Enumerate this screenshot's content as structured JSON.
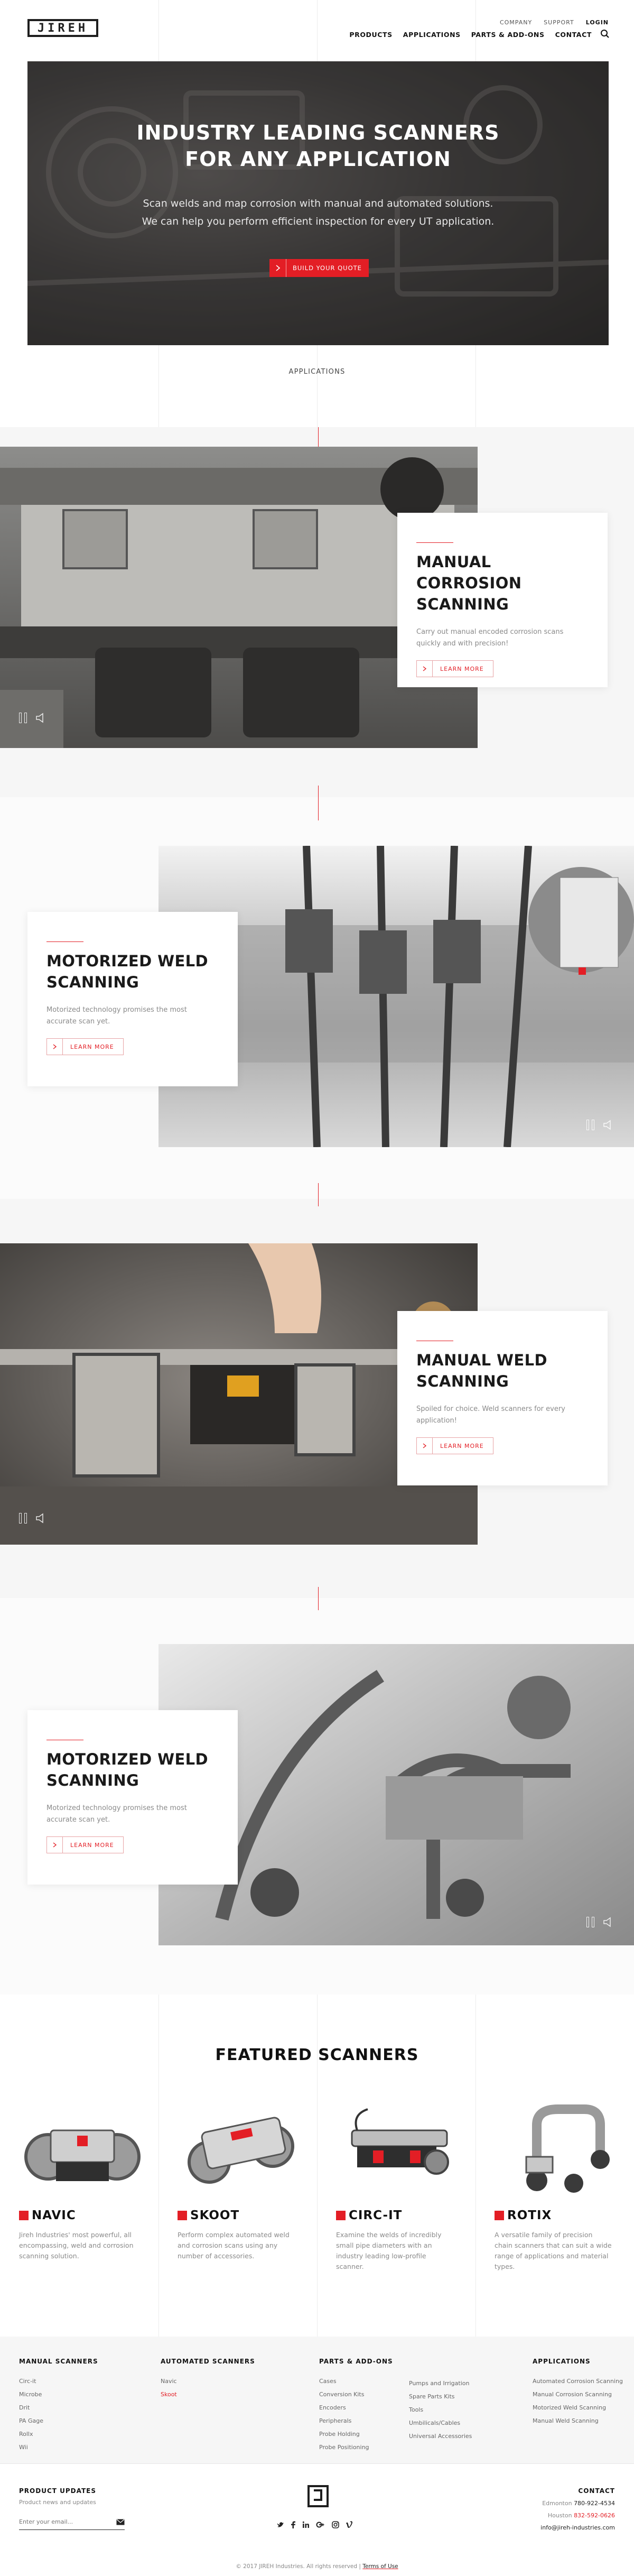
{
  "header": {
    "logo_text": "JIREH",
    "utility_nav": [
      "COMPANY",
      "SUPPORT",
      "LOGIN"
    ],
    "main_nav": [
      "PRODUCTS",
      "APPLICATIONS",
      "PARTS & ADD-ONS",
      "CONTACT"
    ],
    "search_icon": "search-icon"
  },
  "hero": {
    "title_line1": "INDUSTRY LEADING SCANNERS",
    "title_line2": "FOR ANY APPLICATION",
    "subtitle_line1": "Scan welds and map corrosion with manual and automated solutions.",
    "subtitle_line2": "We can help you perform efficient inspection for every UT application.",
    "cta_label": "BUILD YOUR QUOTE"
  },
  "applications": {
    "section_label": "APPLICATIONS",
    "items": [
      {
        "title_line1": "MANUAL CORROSION",
        "title_line2": "SCANNING",
        "description": "Carry out manual encoded corrosion scans quickly and with precision!",
        "button": "LEARN MORE"
      },
      {
        "title_line1": "MOTORIZED WELD",
        "title_line2": "SCANNING",
        "description": "Motorized technology promises the most accurate scan yet.",
        "button": "LEARN MORE"
      },
      {
        "title_line1": "MANUAL WELD",
        "title_line2": "SCANNING",
        "description": "Spoiled for choice. Weld scanners for every application!",
        "button": "LEARN MORE"
      },
      {
        "title_line1": "MOTORIZED WELD",
        "title_line2": "SCANNING",
        "description": "Motorized technology promises the most accurate scan yet.",
        "button": "LEARN MORE"
      }
    ]
  },
  "featured": {
    "title": "FEATURED SCANNERS",
    "products": [
      {
        "name": "NAVIC",
        "description": "Jireh Industries' most powerful, all encompassing, weld and corrosion scanning solution."
      },
      {
        "name": "SKOOT",
        "description": "Perform complex automated weld and corrosion scans using any number of accessories."
      },
      {
        "name": "CIRC-IT",
        "description": "Examine the welds of incredibly small pipe diameters with an industry leading low-profile scanner."
      },
      {
        "name": "ROTIX",
        "description": "A versatile family of precision chain scanners that can suit a wide range of applications and material types."
      }
    ]
  },
  "footer": {
    "columns": [
      {
        "heading": "MANUAL SCANNERS",
        "links": [
          "Circ-it",
          "Microbe",
          "Drit",
          "PA Gage",
          "Rollx",
          "Wii"
        ]
      },
      {
        "heading": "AUTOMATED SCANNERS",
        "links": [
          "Navic",
          "Skoot"
        ]
      },
      {
        "heading": "PARTS & ADD-ONS",
        "links": [
          "Cases",
          "Conversion Kits",
          "Encoders",
          "Peripherals",
          "Probe Holding",
          "Probe Positioning"
        ]
      },
      {
        "heading": "",
        "links": [
          "Pumps and Irrigation",
          "Spare Parts Kits",
          "Tools",
          "Umbilicals/Cables",
          "Universal Accessories"
        ]
      },
      {
        "heading": "APPLICATIONS",
        "links": [
          "Automated Corrosion Scanning",
          "Manual Corrosion Scanning",
          "Motorized Weld Scanning",
          "Manual Weld Scanning"
        ]
      }
    ],
    "updates": {
      "heading": "PRODUCT UPDATES",
      "text": "Product news and updates",
      "email_placeholder": "Enter your email..."
    },
    "social_icons": [
      "twitter-icon",
      "facebook-icon",
      "linkedin-icon",
      "google-plus-icon",
      "instagram-icon",
      "vimeo-icon"
    ],
    "contact": {
      "heading": "CONTACT",
      "edmonton_label": "Edmonton",
      "edmonton_phone": "780-922-4534",
      "houston_label": "Houston",
      "houston_phone": "832-592-0626",
      "email": "info@jireh-industries.com"
    },
    "copyright": "© 2017 JIREH Industries. All rights reserved",
    "terms": "Terms of Use"
  },
  "colors": {
    "accent": "#e31e25",
    "band": "#f6f6f6",
    "text_dark": "#111111"
  }
}
